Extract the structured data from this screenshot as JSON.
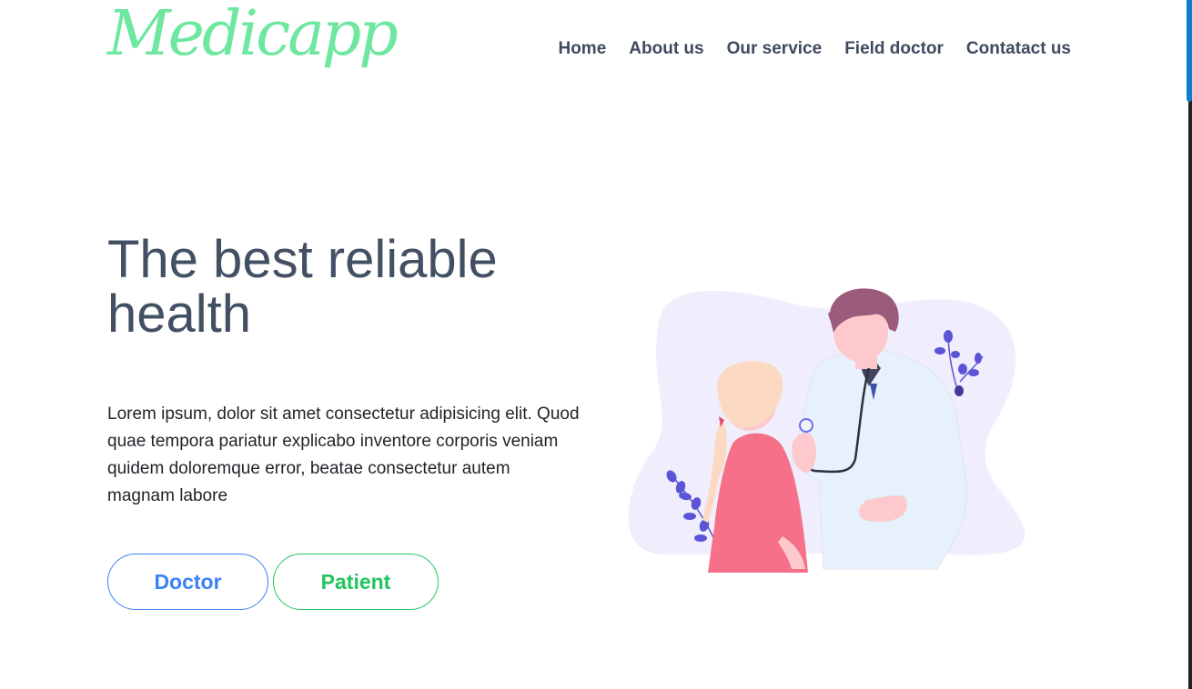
{
  "brand": {
    "logo_text": "Medicapp",
    "color": "#6ee7a0"
  },
  "nav": {
    "items": [
      {
        "label": "Home"
      },
      {
        "label": "About us"
      },
      {
        "label": "Our service"
      },
      {
        "label": "Field doctor"
      },
      {
        "label": "Contatact us"
      }
    ]
  },
  "hero": {
    "title": "The best reliable health",
    "description": "Lorem ipsum, dolor sit amet consectetur adipisicing elit. Quod quae tempora pariatur explicabo inventore corporis veniam quidem doloremque error, beatae consectetur autem magnam labore",
    "buttons": {
      "doctor": {
        "label": "Doctor",
        "color": "#3b82f6"
      },
      "patient": {
        "label": "Patient",
        "color": "#22c55e"
      }
    }
  },
  "illustration": {
    "icon": "doctor-patient-illustration"
  },
  "colors": {
    "heading": "#435064",
    "nav_text": "#3f4a5e",
    "blob": "#f0eefc",
    "leaf": "#5b54d6"
  }
}
